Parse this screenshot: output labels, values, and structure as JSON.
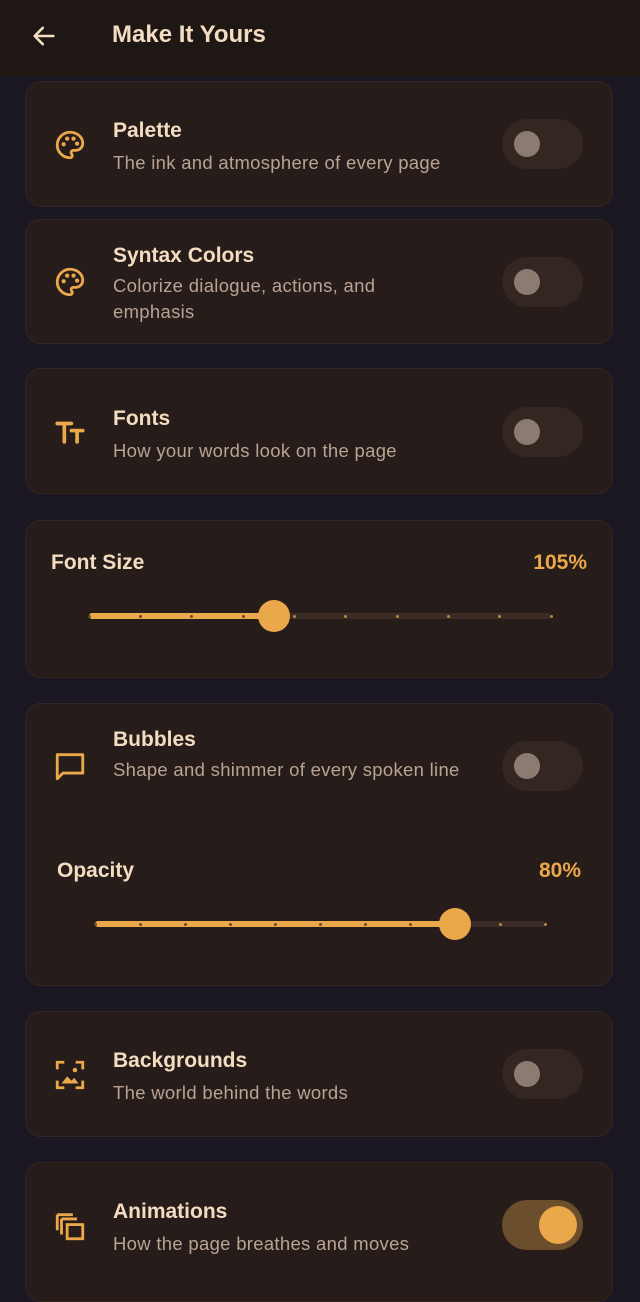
{
  "appbar": {
    "title": "Make It Yours",
    "back_icon": "arrow-left-icon"
  },
  "colors": {
    "accent": "#eaa84a",
    "card": "#261c19",
    "text": "#f3dcc0",
    "subtext": "#b9a494"
  },
  "palette": {
    "title": "Palette",
    "subtitle": "The ink and atmosphere of every page",
    "icon": "palette-icon",
    "enabled": false
  },
  "syntax": {
    "title": "Syntax Colors",
    "subtitle": "Colorize dialogue, actions, and emphasis",
    "icon": "palette-icon",
    "enabled": false
  },
  "fonts": {
    "title": "Fonts",
    "subtitle": "How your words look on the page",
    "icon": "text-size-icon",
    "enabled": false
  },
  "font_size": {
    "label": "Font Size",
    "value": "105%",
    "position": 0.4,
    "steps": 9
  },
  "bubbles": {
    "title": "Bubbles",
    "subtitle": "Shape and shimmer of every spoken line",
    "icon": "chat-bubble-icon",
    "enabled": false,
    "opacity": {
      "label": "Opacity",
      "value": "80%",
      "position": 0.8,
      "steps": 10
    }
  },
  "backgrounds": {
    "title": "Backgrounds",
    "subtitle": "The world behind the words",
    "icon": "image-icon",
    "enabled": false
  },
  "animations": {
    "title": "Animations",
    "subtitle": "How the page breathes and moves",
    "icon": "layers-icon",
    "enabled": true
  }
}
